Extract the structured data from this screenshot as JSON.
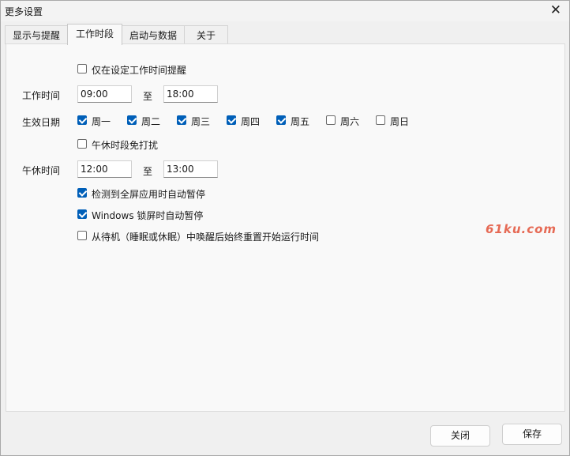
{
  "window": {
    "title": "更多设置"
  },
  "tabs": [
    {
      "label": "显示与提醒"
    },
    {
      "label": "工作时段"
    },
    {
      "label": "启动与数据"
    },
    {
      "label": "关于"
    }
  ],
  "work": {
    "only_remind_label": "仅在设定工作时间提醒",
    "work_time_label": "工作时间",
    "start_value": "09:00",
    "to_label": "至",
    "end_value": "18:00",
    "days_label": "生效日期",
    "days": [
      {
        "label": "周一",
        "checked": true
      },
      {
        "label": "周二",
        "checked": true
      },
      {
        "label": "周三",
        "checked": true
      },
      {
        "label": "周四",
        "checked": true
      },
      {
        "label": "周五",
        "checked": true
      },
      {
        "label": "周六",
        "checked": false
      },
      {
        "label": "周日",
        "checked": false
      }
    ],
    "lunch_dnd_label": "午休时段免打扰",
    "lunch_time_label": "午休时间",
    "lunch_start": "12:00",
    "lunch_to": "至",
    "lunch_end": "13:00",
    "fullscreen_pause_label": "检测到全屏应用时自动暂停",
    "lock_pause_label": "Windows 锁屏时自动暂停",
    "wake_restart_label": "从待机（睡眠或休眠）中唤醒后始终重置开始运行时间"
  },
  "buttons": {
    "close": "关闭",
    "save": "保存"
  },
  "watermark": "61ku.com",
  "colors": {
    "accent": "#005fb8",
    "watermark": "#e66a55"
  }
}
